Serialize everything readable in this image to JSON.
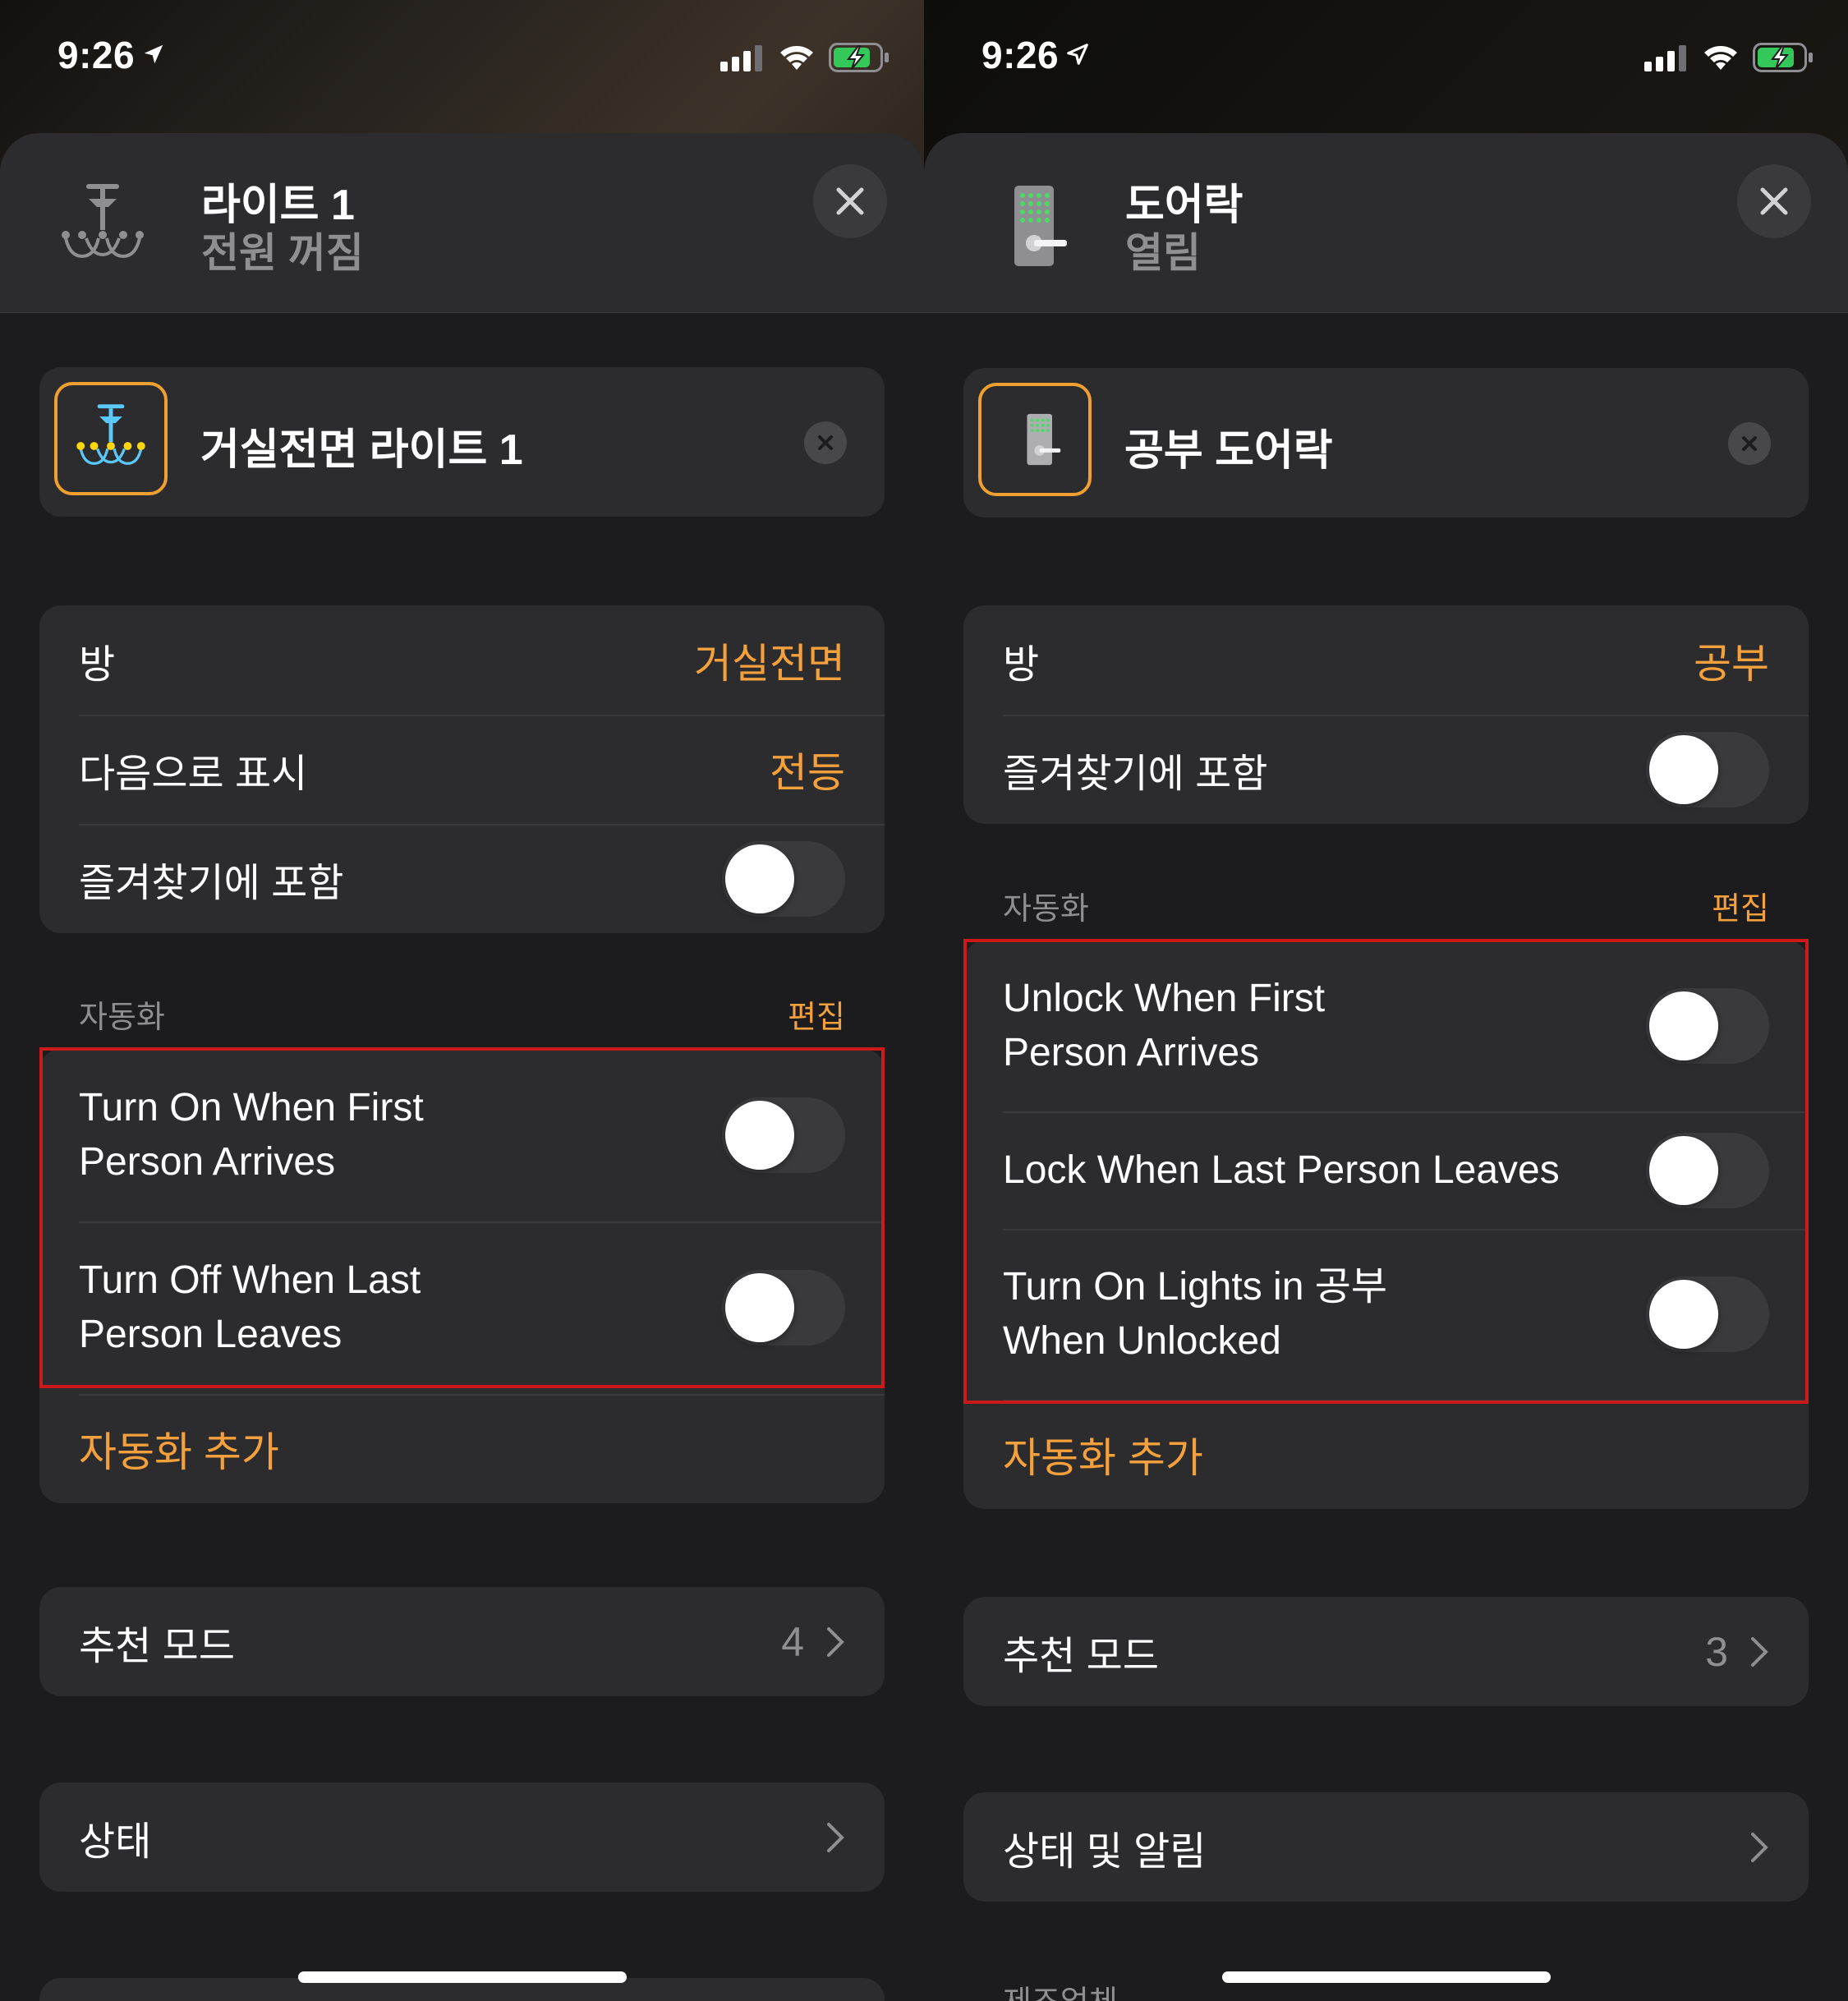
{
  "left": {
    "status_time": "9:26",
    "header": {
      "title": "라이트 1",
      "subtitle": "전원 꺼짐"
    },
    "name_field": "거실전면 라이트 1",
    "settings": {
      "room_label": "방",
      "room_value": "거실전면",
      "display_label": "다음으로 표시",
      "display_value": "전등",
      "favorite_label": "즐겨찾기에 포함"
    },
    "automation": {
      "header": "자동화",
      "edit": "편집",
      "items": [
        "Turn On When First Person Arrives",
        "Turn Off When Last Person Leaves"
      ],
      "item_lines": [
        [
          "Turn On When First",
          "Person Arrives"
        ],
        [
          "Turn Off When Last",
          "Person Leaves"
        ]
      ],
      "add": "자동화 추가"
    },
    "recommend": {
      "label": "추천 모드",
      "count": "4"
    },
    "status_row": {
      "label": "상태"
    }
  },
  "right": {
    "status_time": "9:26",
    "header": {
      "title": "도어락",
      "subtitle": "열림"
    },
    "name_field": "공부 도어락",
    "settings": {
      "room_label": "방",
      "room_value": "공부",
      "favorite_label": "즐겨찾기에 포함"
    },
    "automation": {
      "header": "자동화",
      "edit": "편집",
      "item_lines": [
        [
          "Unlock When First",
          "Person Arrives"
        ],
        [
          "Lock When Last Person Leaves"
        ],
        [
          "Turn On Lights in 공부",
          "When Unlocked"
        ]
      ],
      "add": "자동화 추가"
    },
    "recommend": {
      "label": "추천 모드",
      "count": "3"
    },
    "status_row": {
      "label": "상태 및 알림"
    },
    "footer_peek": "제조업체"
  },
  "colors": {
    "accent": "#f4a03c",
    "highlight": "#cc1a1a",
    "sheet": "#1c1c1e",
    "card": "#2c2c2e"
  },
  "icons": [
    "location-arrow-icon",
    "signal-icon",
    "wifi-icon",
    "battery-charging-icon",
    "chandelier-icon",
    "door-lock-icon",
    "close-icon",
    "chevron-right-icon"
  ]
}
